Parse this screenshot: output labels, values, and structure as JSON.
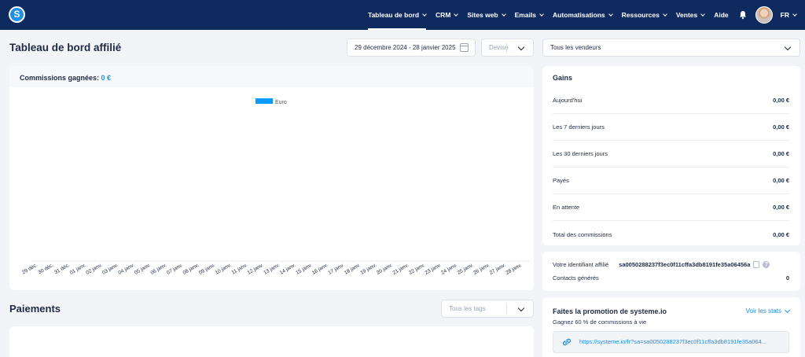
{
  "app": {
    "logo_letter": "S"
  },
  "nav": {
    "items": [
      {
        "label": "Tableau de bord",
        "has_chevron": true,
        "active": true
      },
      {
        "label": "CRM",
        "has_chevron": true
      },
      {
        "label": "Sites web",
        "has_chevron": true
      },
      {
        "label": "Emails",
        "has_chevron": true
      },
      {
        "label": "Automatisations",
        "has_chevron": true
      },
      {
        "label": "Ressources",
        "has_chevron": true
      },
      {
        "label": "Ventes",
        "has_chevron": true
      },
      {
        "label": "Aide",
        "has_chevron": false
      }
    ],
    "icons": [
      "bell-icon",
      "avatar"
    ],
    "language": "FR"
  },
  "header": {
    "title": "Tableau de bord affilié",
    "date_range": "29 décembre 2024 - 28 janvier 2025",
    "currency_placeholder": "Devise",
    "vendors_select": "Tous les vendeurs"
  },
  "commissions": {
    "label": "Commissions gagnées:",
    "value": "0 €"
  },
  "chart_data": {
    "type": "bar",
    "series": [
      {
        "name": "Euro",
        "values": [
          0,
          0,
          0,
          0,
          0,
          0,
          0,
          0,
          0,
          0,
          0,
          0,
          0,
          0,
          0,
          0,
          0,
          0,
          0,
          0,
          0,
          0,
          0,
          0,
          0,
          0,
          0,
          0,
          0,
          0,
          0
        ],
        "color": "#0d99ff"
      }
    ],
    "categories": [
      "29 déc.",
      "30 déc.",
      "31 déc.",
      "01 janv.",
      "02 janv.",
      "03 janv.",
      "04 janv.",
      "05 janv.",
      "06 janv.",
      "07 janv.",
      "08 janv.",
      "09 janv.",
      "10 janv.",
      "11 janv.",
      "12 janv.",
      "13 janv.",
      "14 janv.",
      "15 janv.",
      "16 janv.",
      "17 janv.",
      "18 janv.",
      "19 janv.",
      "20 janv.",
      "21 janv.",
      "22 janv.",
      "23 janv.",
      "24 janv.",
      "25 janv.",
      "26 janv.",
      "27 janv.",
      "28 janv."
    ],
    "legend": "top-center",
    "grid": false
  },
  "gains": {
    "title": "Gains",
    "rows": [
      {
        "label": "Aujourd'hui",
        "amount": "0,00 €"
      },
      {
        "label": "Les 7 derniers jours",
        "amount": "0,00 €"
      },
      {
        "label": "Les 30 derniers jours",
        "amount": "0,00 €"
      },
      {
        "label": "Payés",
        "amount": "0,00 €"
      },
      {
        "label": "En attente",
        "amount": "0,00 €"
      },
      {
        "label": "Total des commissions",
        "amount": "0,00 €"
      }
    ]
  },
  "affiliate": {
    "id_label": "Votre identifiant affilié",
    "id_value": "sa0050288237f3ec0f11cffa3db8191fe35a06456a",
    "contacts_label": "Contacts générés",
    "contacts_value": "0"
  },
  "promo": {
    "title": "Faites la promotion de systeme.io",
    "stats_link": "Voir les stats",
    "subtitle": "Gagnez 60 % de commissions à vie",
    "link": "https://systeme.io/fr?sa=sa0050288237f3ec0f11cffa3db8191fe35a064..."
  },
  "payments": {
    "title": "Paiements",
    "tags_placeholder": "Tous les tags"
  },
  "colors": {
    "navbar": "#0f2a5f",
    "accent": "#1f8fe6",
    "series": "#0d99ff"
  }
}
